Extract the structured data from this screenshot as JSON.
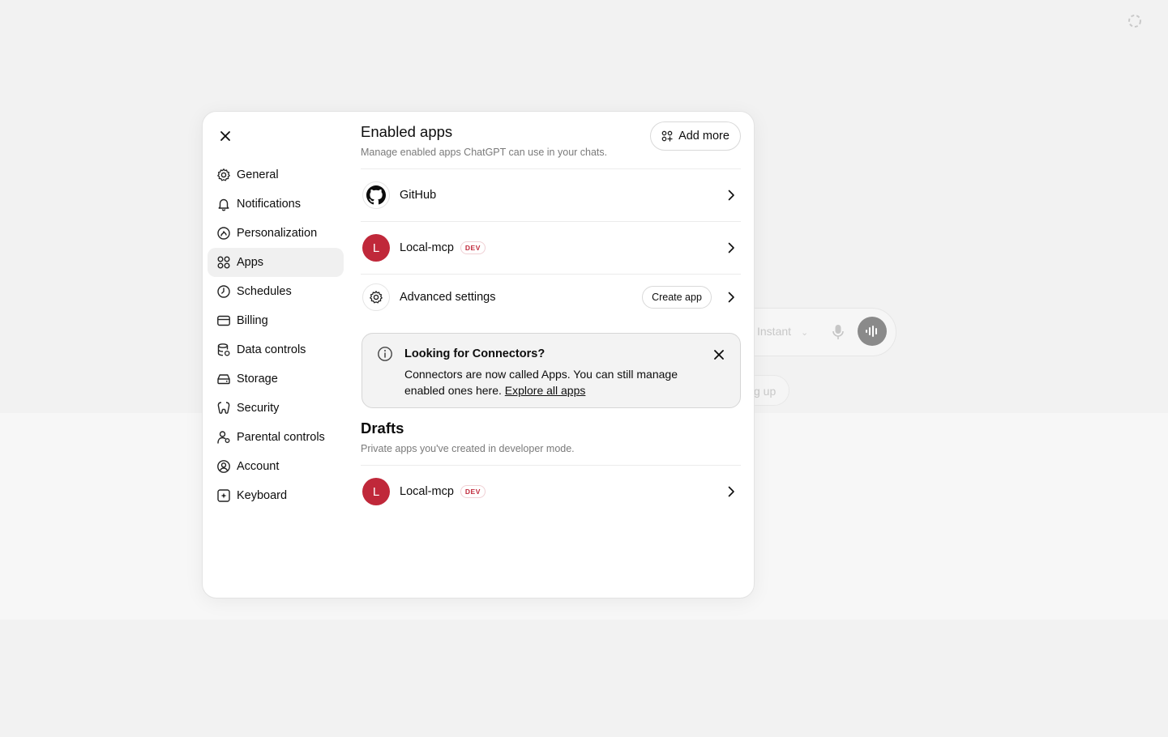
{
  "background": {
    "model_label": "Instant",
    "pill_text": "g up"
  },
  "sidebar": {
    "items": [
      {
        "label": "General",
        "icon": "gear-icon"
      },
      {
        "label": "Notifications",
        "icon": "bell-icon"
      },
      {
        "label": "Personalization",
        "icon": "personalization-icon"
      },
      {
        "label": "Apps",
        "icon": "apps-grid-icon",
        "active": true
      },
      {
        "label": "Schedules",
        "icon": "clock-icon"
      },
      {
        "label": "Billing",
        "icon": "credit-card-icon"
      },
      {
        "label": "Data controls",
        "icon": "database-icon"
      },
      {
        "label": "Storage",
        "icon": "storage-icon"
      },
      {
        "label": "Security",
        "icon": "shield-icon"
      },
      {
        "label": "Parental controls",
        "icon": "parental-icon"
      },
      {
        "label": "Account",
        "icon": "account-circle-icon"
      },
      {
        "label": "Keyboard",
        "icon": "keyboard-icon"
      }
    ]
  },
  "enabled_apps": {
    "title": "Enabled apps",
    "subtitle": "Manage enabled apps ChatGPT can use in your chats.",
    "add_more_label": "Add more",
    "apps": [
      {
        "name": "GitHub",
        "logo": "github-icon"
      },
      {
        "name": "Local-mcp",
        "logo_letter": "L",
        "badge": "DEV"
      }
    ],
    "advanced": {
      "label": "Advanced settings",
      "create_app_label": "Create app"
    }
  },
  "info_box": {
    "title": "Looking for Connectors?",
    "text": "Connectors are now called Apps. You can still manage enabled ones here.",
    "link": "Explore all apps"
  },
  "drafts": {
    "title": "Drafts",
    "subtitle": "Private apps you've created in developer mode.",
    "apps": [
      {
        "name": "Local-mcp",
        "logo_letter": "L",
        "badge": "DEV"
      }
    ]
  },
  "colors": {
    "accent_red": "#c0283a",
    "text": "#0d0d0d",
    "muted": "#7a7a7a"
  }
}
